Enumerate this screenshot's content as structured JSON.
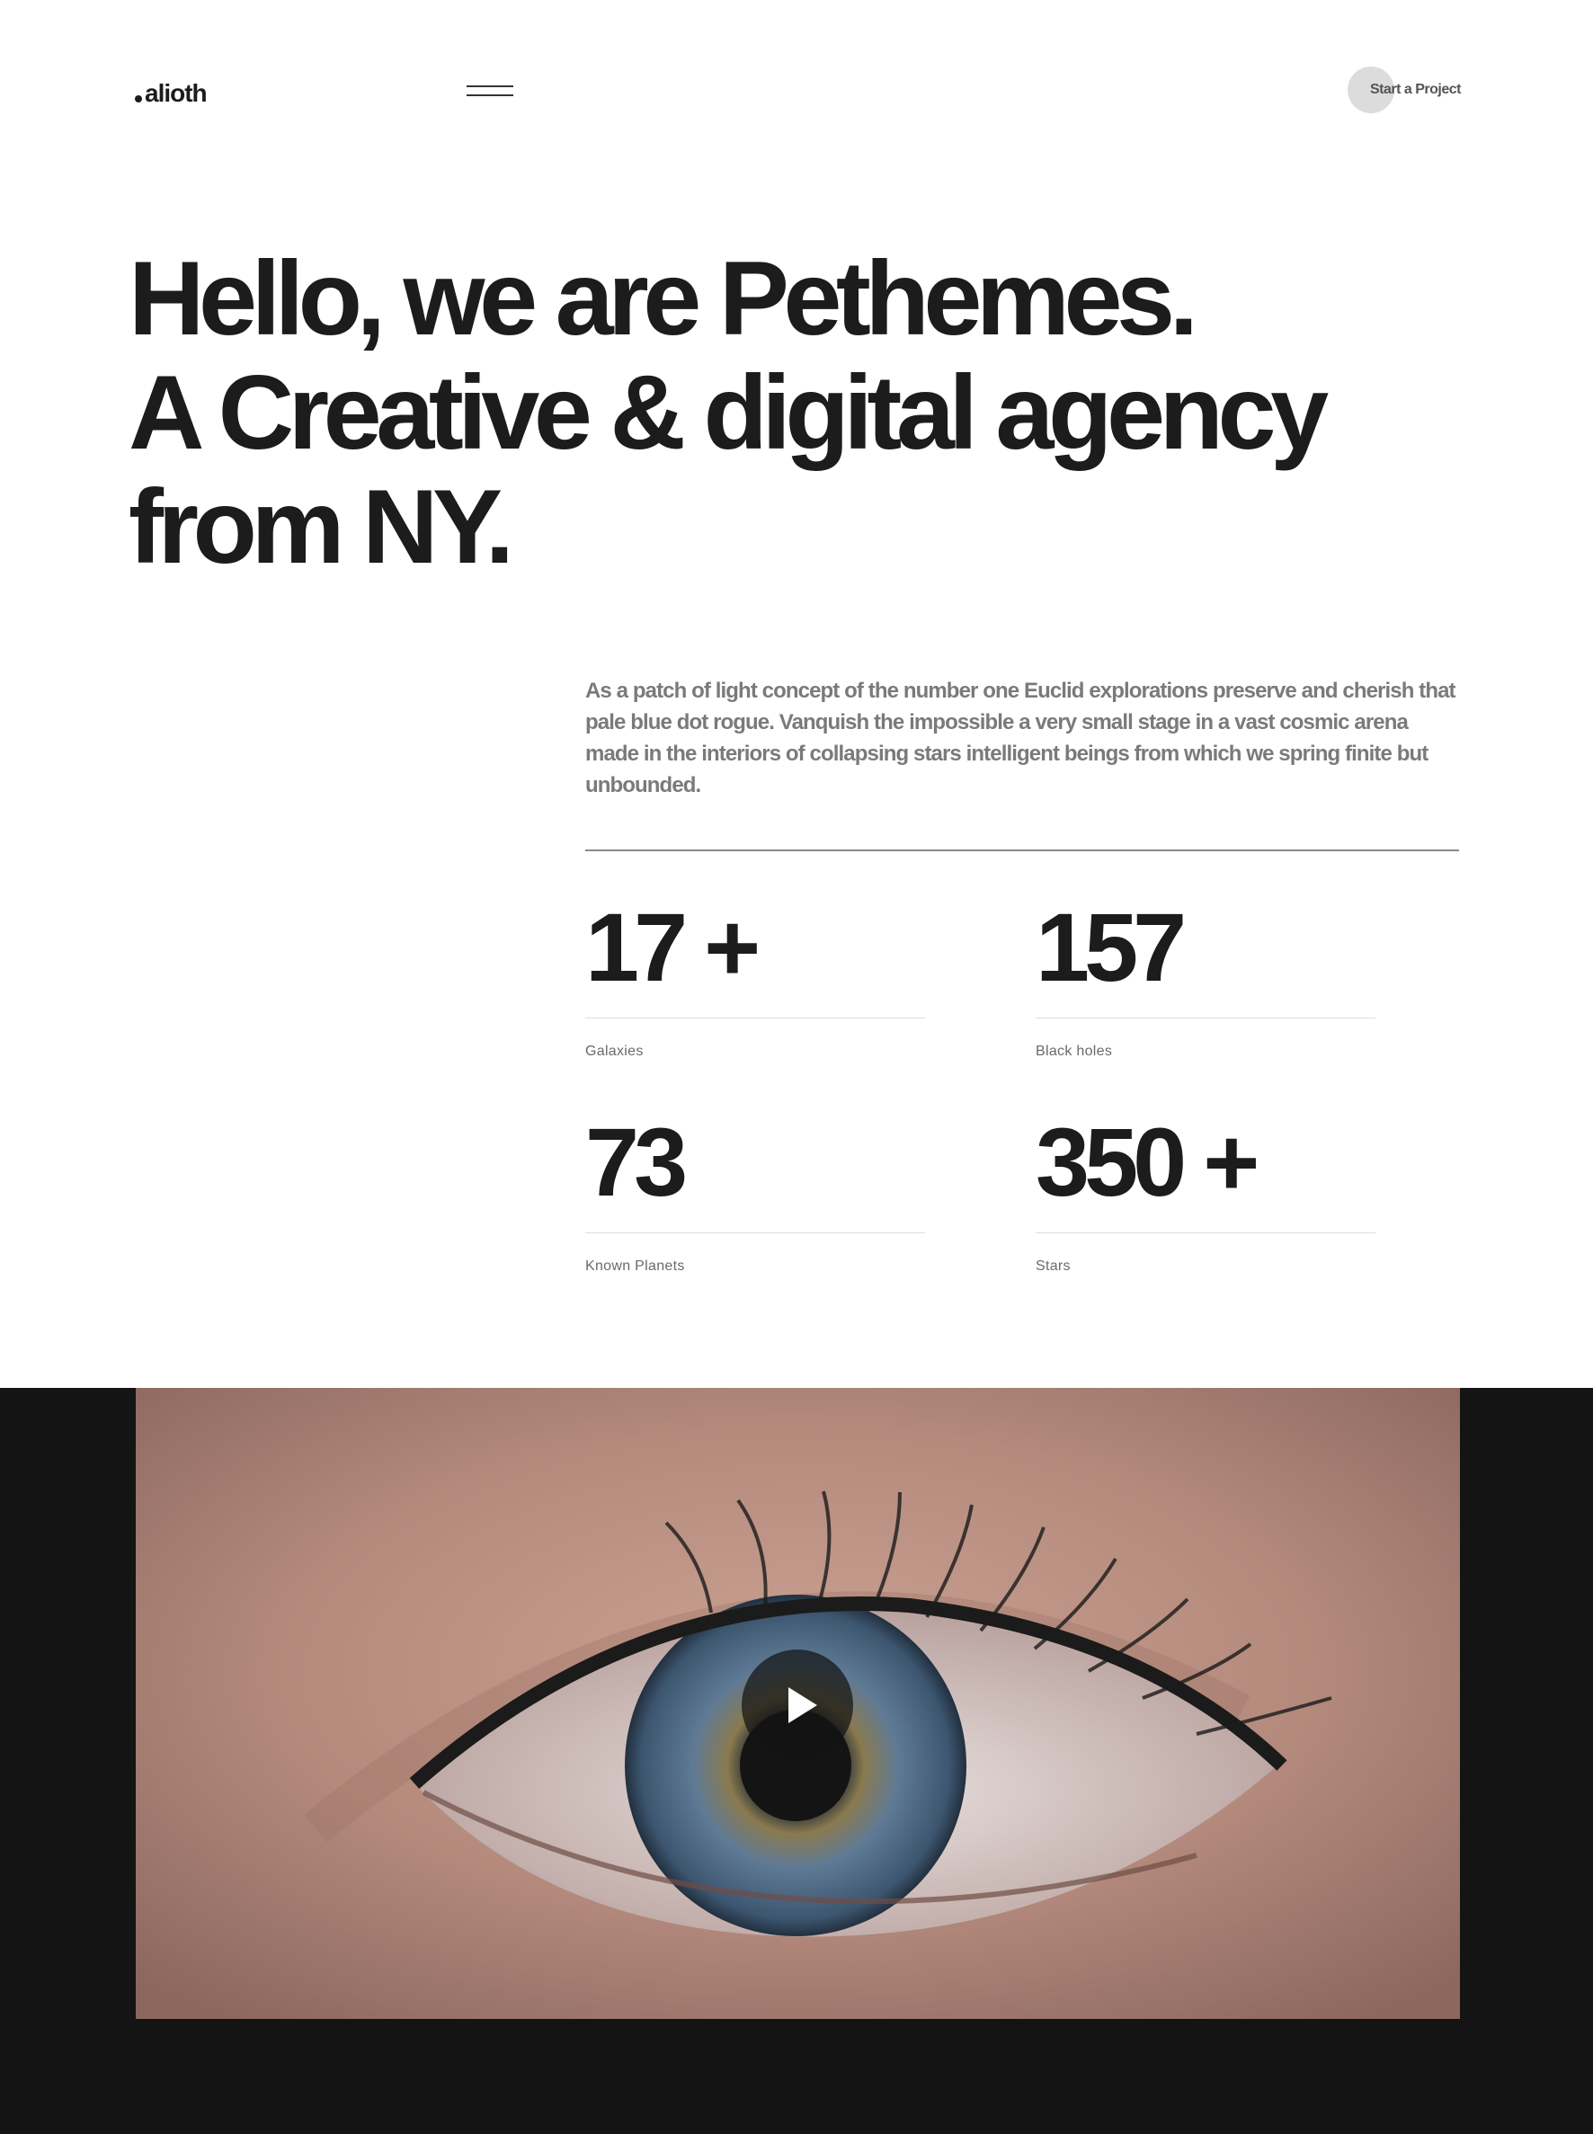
{
  "header": {
    "logo_text": "alioth",
    "menu_icon": "hamburger-icon",
    "cta_label": "Start a Project"
  },
  "hero": {
    "line1": "Hello, we are Pethemes.",
    "line2": "A Creative & digital agency",
    "line3": "from NY."
  },
  "intro": {
    "text": "As a patch of light concept of the number one Euclid explorations preserve and cherish that pale blue dot rogue. Vanquish the impossible a very small stage in a vast cosmic arena made in the interiors of collapsing stars intelligent beings from which we spring finite but unbounded."
  },
  "stats": [
    {
      "value": "17 +",
      "label": "Galaxies"
    },
    {
      "value": "157",
      "label": "Black holes"
    },
    {
      "value": "73",
      "label": "Known Planets"
    },
    {
      "value": "350 +",
      "label": "Stars"
    }
  ],
  "video": {
    "poster_subject": "close-up eye",
    "play_icon": "play-icon"
  },
  "colors": {
    "text": "#1c1c1c",
    "muted": "#7a7a7a",
    "dark_band": "#141414",
    "cta_circle": "#dcdcdc"
  }
}
